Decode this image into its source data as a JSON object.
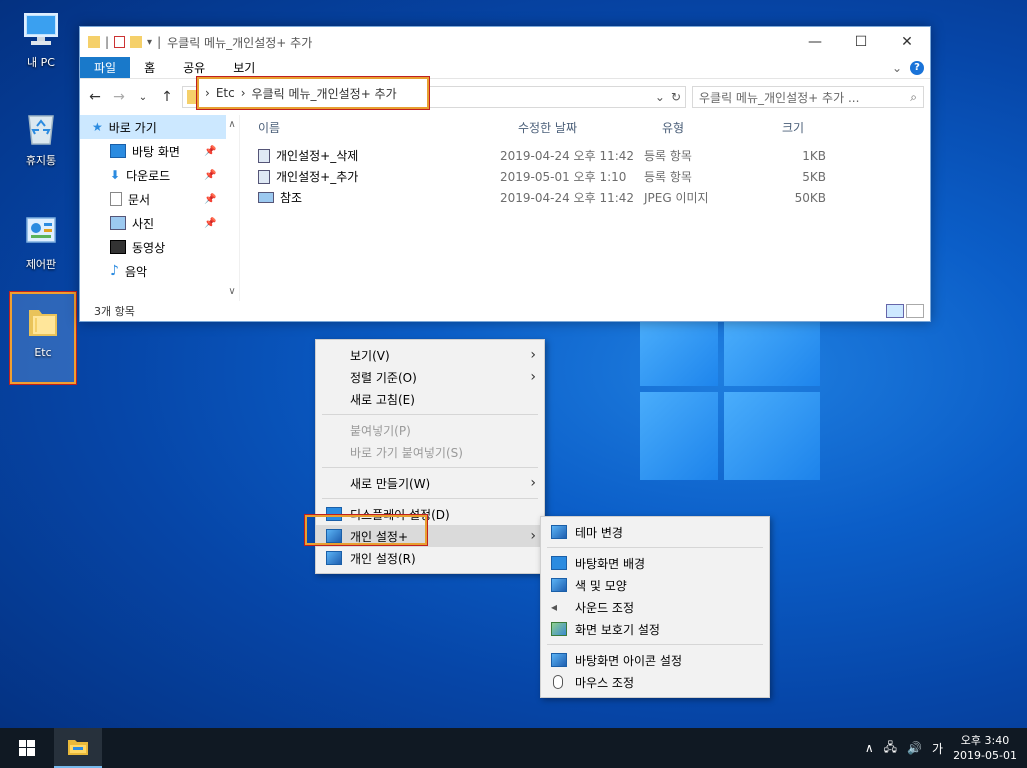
{
  "desktop": {
    "icons": [
      {
        "label": "내 PC"
      },
      {
        "label": "휴지통"
      },
      {
        "label": "제어판"
      },
      {
        "label": "Etc"
      }
    ]
  },
  "explorer": {
    "title": "우클릭 메뉴_개인설정+ 추가",
    "window_controls": {
      "minimize": "—",
      "maximize": "☐",
      "close": "✕"
    },
    "ribbon_tabs": [
      "파일",
      "홈",
      "공유",
      "보기"
    ],
    "address": {
      "root": "Etc",
      "current": "우클릭 메뉴_개인설정+ 추가"
    },
    "search_placeholder": "우클릭 메뉴_개인설정+ 추가 ...",
    "nav": {
      "quick_access": "바로 가기",
      "items": [
        "바탕 화면",
        "다운로드",
        "문서",
        "사진",
        "동영상",
        "음악"
      ]
    },
    "columns": {
      "name": "이름",
      "modified": "수정한 날짜",
      "type": "유형",
      "size": "크기"
    },
    "files": [
      {
        "name": "개인설정+_삭제",
        "modified": "2019-04-24 오후 11:42",
        "type": "등록 항목",
        "size": "1KB"
      },
      {
        "name": "개인설정+_추가",
        "modified": "2019-05-01 오후 1:10",
        "type": "등록 항목",
        "size": "5KB"
      },
      {
        "name": "참조",
        "modified": "2019-04-24 오후 11:42",
        "type": "JPEG 이미지",
        "size": "50KB"
      }
    ],
    "status": "3개 항목"
  },
  "context_menu": {
    "view": "보기(V)",
    "sort": "정렬 기준(O)",
    "refresh": "새로 고침(E)",
    "paste": "붙여넣기(P)",
    "paste_shortcut": "바로 가기 붙여넣기(S)",
    "new": "새로 만들기(W)",
    "display": "디스플레이 설정(D)",
    "personalize_plus": "개인 설정+",
    "personalize": "개인 설정(R)"
  },
  "submenu": {
    "theme": "테마 변경",
    "background": "바탕화면 배경",
    "color": "색 및 모양",
    "sound": "사운드 조정",
    "screensaver": "화면 보호기 설정",
    "desktop_icons": "바탕화면 아이콘 설정",
    "mouse": "마우스 조정"
  },
  "taskbar": {
    "tray_chevron": "∧",
    "ime": "가",
    "time": "오후 3:40",
    "date": "2019-05-01"
  }
}
